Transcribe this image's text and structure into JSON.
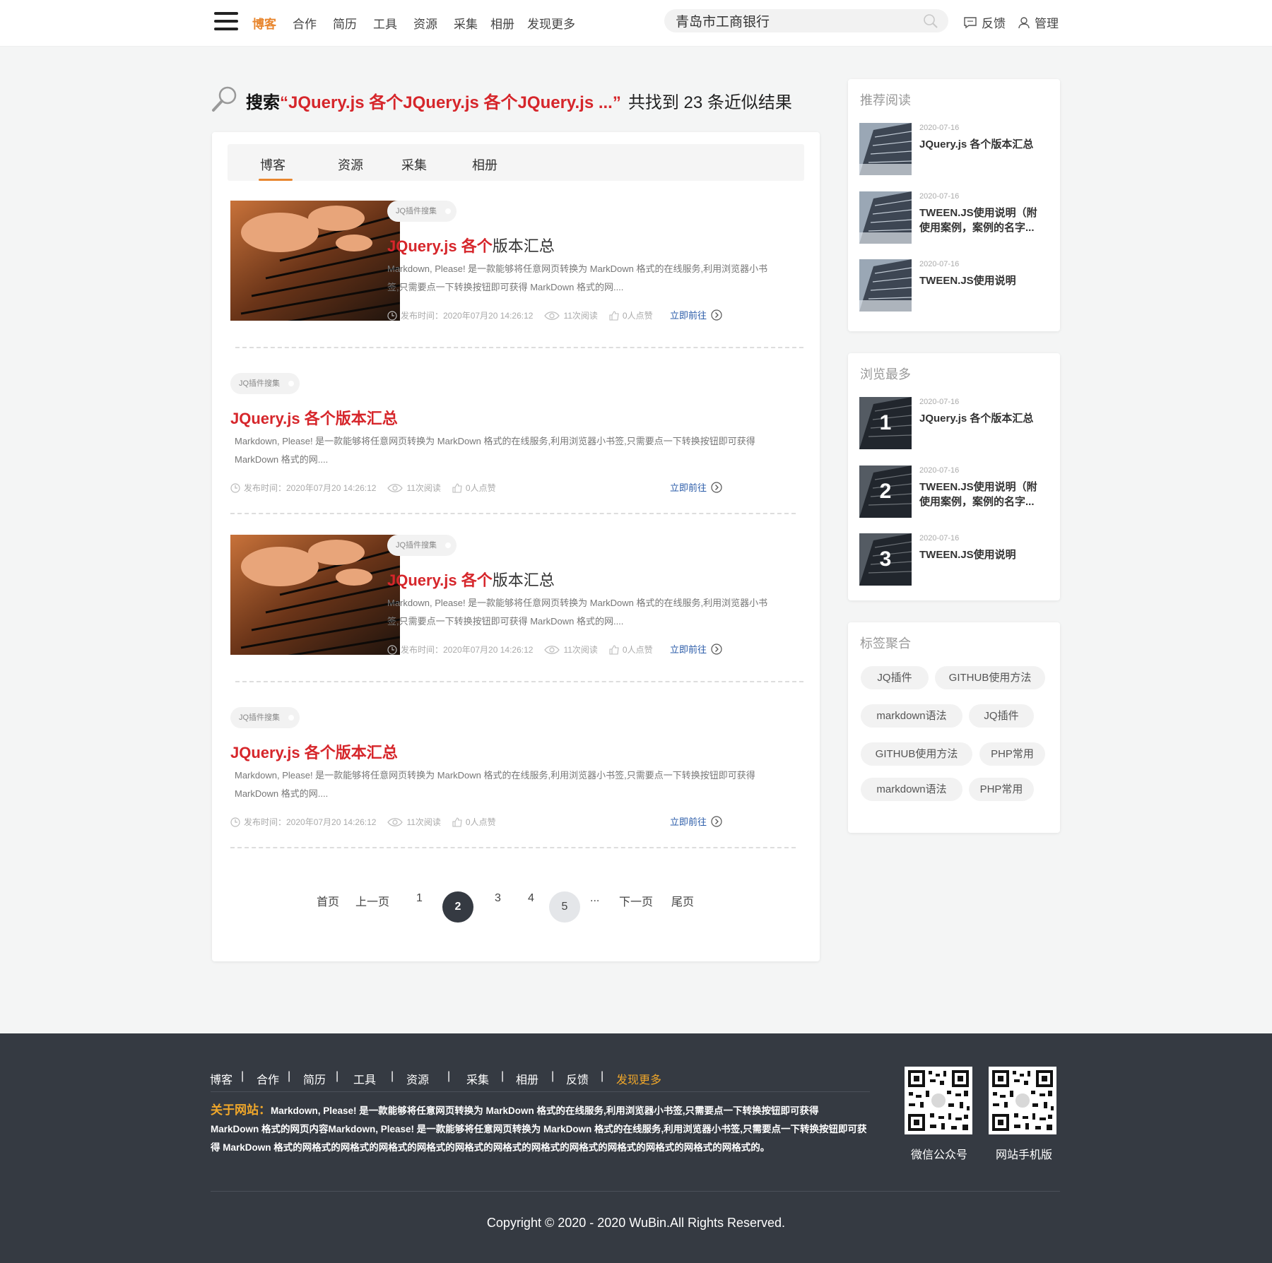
{
  "nav": {
    "items": [
      "博客",
      "合作",
      "简历",
      "工具",
      "资源",
      "采集",
      "相册",
      "发现更多"
    ],
    "search_value": "青岛市工商银行",
    "feedback": "反馈",
    "admin": "管理",
    "accent": "#e8862e"
  },
  "search": {
    "prefix": "搜索",
    "keyword": "“JQuery.js 各个JQuery.js 各个JQuery.js ...”",
    "result_text": "共找到 23 条近似结果"
  },
  "tabs": [
    "博客",
    "资源",
    "采集",
    "相册"
  ],
  "posts": [
    {
      "tag": "JQ插件搜集",
      "title_kw": "JQuery.js 各个",
      "title_rest": "版本汇总",
      "excerpt": "Markdown, Please! 是一款能够将任意网页转换为 MarkDown 格式的在线服务,利用浏览器小书签,只需要点一下转换按钮即可获得 MarkDown 格式的网....",
      "date": "发布时间：2020年07月20 14:26:12",
      "views": "11次阅读",
      "likes": "0人点赞",
      "goto": "立即前往"
    },
    {
      "tag": "JQ插件搜集",
      "title_kw": "JQuery.js 各个版本汇总",
      "title_rest": "",
      "excerpt": "Markdown, Please! 是一款能够将任意网页转换为 MarkDown 格式的在线服务,利用浏览器小书签,只需要点一下转换按钮即可获得 MarkDown 格式的网....",
      "date": "发布时间：2020年07月20 14:26:12",
      "views": "11次阅读",
      "likes": "0人点赞",
      "goto": "立即前往"
    },
    {
      "tag": "JQ插件搜集",
      "title_kw": "JQuery.js 各个",
      "title_rest": "版本汇总",
      "excerpt": "Markdown, Please! 是一款能够将任意网页转换为 MarkDown 格式的在线服务,利用浏览器小书签,只需要点一下转换按钮即可获得 MarkDown 格式的网....",
      "date": "发布时间：2020年07月20 14:26:12",
      "views": "11次阅读",
      "likes": "0人点赞",
      "goto": "立即前往"
    },
    {
      "tag": "JQ插件搜集",
      "title_kw": "JQuery.js 各个版本汇总",
      "title_rest": "",
      "excerpt": "Markdown, Please! 是一款能够将任意网页转换为 MarkDown 格式的在线服务,利用浏览器小书签,只需要点一下转换按钮即可获得 MarkDown 格式的网....",
      "date": "发布时间：2020年07月20 14:26:12",
      "views": "11次阅读",
      "likes": "0人点赞",
      "goto": "立即前往"
    }
  ],
  "pagination": {
    "first": "首页",
    "prev": "上一页",
    "pages": [
      "1",
      "2",
      "3",
      "4",
      "5"
    ],
    "current": "2",
    "ellipsis": "...",
    "next": "下一页",
    "last": "尾页"
  },
  "sidebar": {
    "recommend": {
      "title": "推荐阅读",
      "items": [
        {
          "date": "2020-07-16",
          "name": "JQuery.js 各个版本汇总"
        },
        {
          "date": "2020-07-16",
          "name": "TWEEN.JS使用说明（附使用案例，案例的名字..."
        },
        {
          "date": "2020-07-16",
          "name": "TWEEN.JS使用说明"
        }
      ]
    },
    "most_viewed": {
      "title": "浏览最多",
      "items": [
        {
          "rank": "1",
          "date": "2020-07-16",
          "name": "JQuery.js 各个版本汇总"
        },
        {
          "rank": "2",
          "date": "2020-07-16",
          "name": "TWEEN.JS使用说明（附使用案例，案例的名字..."
        },
        {
          "rank": "3",
          "date": "2020-07-16",
          "name": "TWEEN.JS使用说明"
        }
      ]
    },
    "tags": {
      "title": "标签聚合",
      "items": [
        "JQ插件",
        "GITHUB使用方法",
        "markdown语法",
        "JQ插件",
        "GITHUB使用方法",
        "PHP常用",
        "markdown语法",
        "PHP常用"
      ]
    }
  },
  "footer": {
    "links": [
      "博客",
      "合作",
      "简历",
      "工具",
      "资源",
      "采集",
      "相册",
      "反馈",
      "发现更多"
    ],
    "about_label": "关于网站：",
    "about_text": "Markdown, Please! 是一款能够将任意网页转换为 MarkDown 格式的在线服务,利用浏览器小书签,只需要点一下转换按钮即可获得 MarkDown 格式的网页内容Markdown, Please! 是一款能够将任意网页转换为 MarkDown 格式的在线服务,利用浏览器小书签,只需要点一下转换按钮即可获得 MarkDown 格式的网格式的网格式的网格式的网格式的网格式的网格式的网格式的网格式的网格式的网格式的网格式的网格式的。",
    "qr": [
      "微信公众号",
      "网站手机版"
    ],
    "copyright": "Copyright © 2020 - 2020 WuBin.All Rights Reserved.",
    "highlight": "#f0a72a"
  }
}
